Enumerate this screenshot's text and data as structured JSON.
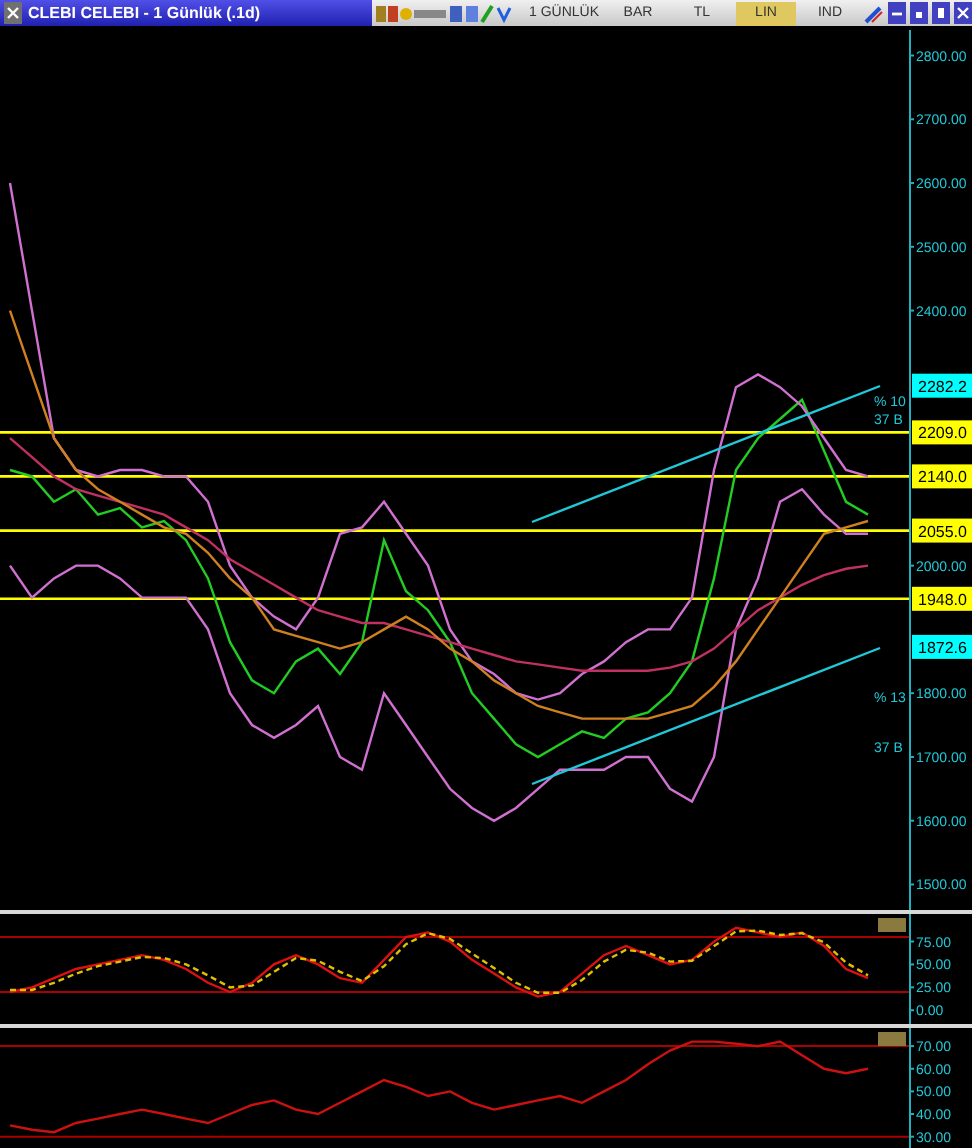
{
  "window": {
    "title": "CLEBI CELEBI - 1 Günlük (.1d)"
  },
  "toolbar": {
    "period": "1 GÜNLÜK",
    "tabs": [
      {
        "label": "BAR",
        "selected": false
      },
      {
        "label": "TL",
        "selected": false
      },
      {
        "label": "LIN",
        "selected": true
      },
      {
        "label": "IND",
        "selected": false
      }
    ]
  },
  "price_panel": {
    "trend_labels": [
      "% 10",
      "37 B",
      "% 13",
      "37 B"
    ],
    "chart_data": {
      "type": "line",
      "ylim": [
        1460,
        2840
      ],
      "yticks": [
        {
          "value": 2800,
          "label": "2800.00"
        },
        {
          "value": 2700,
          "label": "2700.00"
        },
        {
          "value": 2600,
          "label": "2600.00"
        },
        {
          "value": 2500,
          "label": "2500.00"
        },
        {
          "value": 2400,
          "label": "2400.00"
        },
        {
          "value": 2000,
          "label": "2000.00"
        },
        {
          "value": 1800,
          "label": "1800.00"
        },
        {
          "value": 1700,
          "label": "1700.00"
        },
        {
          "value": 1600,
          "label": "1600.00"
        },
        {
          "value": 1500,
          "label": "1500.00"
        }
      ],
      "series": [
        {
          "color": "#22cc22",
          "values": [
            2150,
            2140,
            2100,
            2120,
            2080,
            2090,
            2060,
            2070,
            2040,
            1980,
            1880,
            1820,
            1800,
            1850,
            1870,
            1830,
            1880,
            2040,
            1960,
            1930,
            1880,
            1800,
            1760,
            1720,
            1700,
            1720,
            1740,
            1730,
            1760,
            1770,
            1800,
            1850,
            1980,
            2150,
            2200,
            2230,
            2260,
            2180,
            2100,
            2080
          ]
        },
        {
          "color": "#d070d0",
          "values": [
            2600,
            2400,
            2200,
            2150,
            2140,
            2150,
            2150,
            2140,
            2140,
            2100,
            2000,
            1950,
            1920,
            1900,
            1950,
            2050,
            2060,
            2100,
            2050,
            2000,
            1900,
            1850,
            1830,
            1800,
            1790,
            1800,
            1830,
            1850,
            1880,
            1900,
            1900,
            1950,
            2150,
            2280,
            2300,
            2280,
            2250,
            2200,
            2150,
            2140
          ]
        },
        {
          "color": "#d070d0",
          "values": [
            2000,
            1950,
            1980,
            2000,
            2000,
            1980,
            1950,
            1950,
            1950,
            1900,
            1800,
            1750,
            1730,
            1750,
            1780,
            1700,
            1680,
            1800,
            1750,
            1700,
            1650,
            1620,
            1600,
            1620,
            1650,
            1680,
            1680,
            1680,
            1700,
            1700,
            1650,
            1630,
            1700,
            1900,
            1980,
            2100,
            2120,
            2080,
            2050,
            2050
          ]
        },
        {
          "color": "#c03060",
          "values": [
            2200,
            2170,
            2140,
            2120,
            2110,
            2100,
            2090,
            2080,
            2060,
            2040,
            2010,
            1990,
            1970,
            1950,
            1930,
            1920,
            1910,
            1910,
            1900,
            1890,
            1880,
            1870,
            1860,
            1850,
            1845,
            1840,
            1835,
            1835,
            1835,
            1835,
            1840,
            1850,
            1870,
            1900,
            1930,
            1950,
            1970,
            1985,
            1995,
            2000
          ]
        },
        {
          "color": "#d08020",
          "values": [
            2400,
            2300,
            2200,
            2150,
            2120,
            2100,
            2080,
            2060,
            2050,
            2020,
            1980,
            1950,
            1900,
            1890,
            1880,
            1870,
            1880,
            1900,
            1920,
            1900,
            1870,
            1850,
            1820,
            1800,
            1780,
            1770,
            1760,
            1760,
            1760,
            1760,
            1770,
            1780,
            1810,
            1850,
            1900,
            1950,
            2000,
            2050,
            2060,
            2070
          ]
        }
      ],
      "ref_lines": [
        {
          "axis": "y",
          "value": 2209,
          "label": "2209.0",
          "color": "#ffff00"
        },
        {
          "axis": "y",
          "value": 2140,
          "label": "2140.0",
          "color": "#ffff00"
        },
        {
          "axis": "y",
          "value": 2055,
          "label": "2055.0",
          "color": "#ffff00"
        },
        {
          "axis": "y",
          "value": 1948,
          "label": "1948.0",
          "color": "#ffff00"
        }
      ],
      "annotations": [
        {
          "y": 2282.2,
          "text": "2282.2"
        },
        {
          "y": 1872.6,
          "text": "1872.6"
        }
      ]
    }
  },
  "oscillator_panel": {
    "chart_data": {
      "type": "line",
      "ylim": [
        -15,
        105
      ],
      "yticks": [
        {
          "value": 75,
          "label": "75.00"
        },
        {
          "value": 50,
          "label": "50.00"
        },
        {
          "value": 25,
          "label": "25.00"
        },
        {
          "value": 0,
          "label": "0.00"
        }
      ],
      "series": [
        {
          "color": "#dd1111",
          "values": [
            20,
            25,
            35,
            45,
            50,
            55,
            60,
            55,
            45,
            30,
            20,
            30,
            50,
            60,
            50,
            35,
            30,
            55,
            80,
            85,
            75,
            55,
            40,
            25,
            15,
            20,
            40,
            60,
            70,
            60,
            50,
            55,
            75,
            90,
            85,
            80,
            85,
            70,
            45,
            35
          ]
        },
        {
          "color": "#e0c000",
          "line_style": "dashed",
          "values": [
            22,
            22,
            30,
            40,
            48,
            53,
            58,
            57,
            50,
            38,
            25,
            27,
            42,
            57,
            54,
            42,
            32,
            48,
            72,
            84,
            78,
            62,
            46,
            30,
            19,
            19,
            33,
            53,
            66,
            63,
            53,
            54,
            70,
            86,
            87,
            82,
            84,
            74,
            52,
            38
          ]
        }
      ],
      "ref_lines": [
        {
          "axis": "y",
          "value": 80,
          "color": "#aa0000"
        },
        {
          "axis": "y",
          "value": 20,
          "color": "#aa0000"
        }
      ]
    }
  },
  "strength_panel": {
    "chart_data": {
      "type": "line",
      "ylim": [
        25,
        78
      ],
      "yticks": [
        {
          "value": 70,
          "label": "70.00"
        },
        {
          "value": 60,
          "label": "60.00"
        },
        {
          "value": 50,
          "label": "50.00"
        },
        {
          "value": 40,
          "label": "40.00"
        },
        {
          "value": 30,
          "label": "30.00"
        }
      ],
      "series": [
        {
          "color": "#cc1111",
          "values": [
            35,
            33,
            32,
            36,
            38,
            40,
            42,
            40,
            38,
            36,
            40,
            44,
            46,
            42,
            40,
            45,
            50,
            55,
            52,
            48,
            50,
            45,
            42,
            44,
            46,
            48,
            45,
            50,
            55,
            62,
            68,
            72,
            72,
            71,
            70,
            72,
            66,
            60,
            58,
            60
          ]
        }
      ],
      "ref_lines": [
        {
          "axis": "y",
          "value": 70,
          "color": "#aa0000"
        },
        {
          "axis": "y",
          "value": 30,
          "color": "#aa0000"
        }
      ]
    }
  }
}
